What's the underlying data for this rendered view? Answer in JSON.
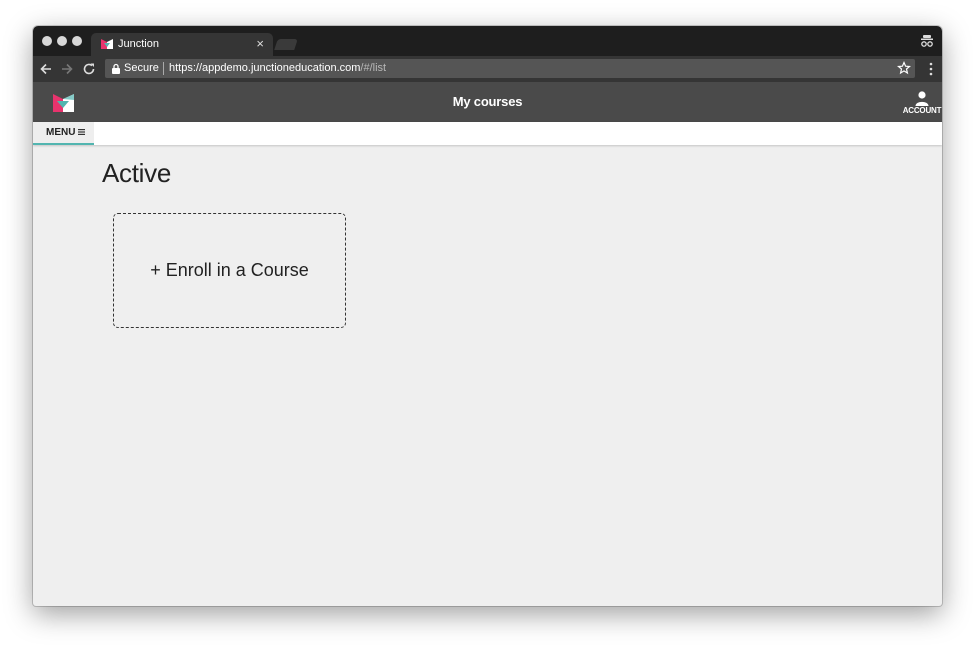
{
  "browser": {
    "tab": {
      "title": "Junction",
      "close_glyph": "×"
    },
    "omnibox": {
      "secure_label": "Secure",
      "url_scheme": "https://",
      "url_host": "appdemo.junctioneducation.com",
      "url_path": "/#/list"
    },
    "icons": [
      "back-arrow-icon",
      "forward-arrow-icon",
      "reload-icon",
      "lock-icon",
      "star-icon",
      "kebab-menu-icon",
      "incognito-icon"
    ]
  },
  "app": {
    "brand_colors": {
      "pink": "#e8336d",
      "teal": "#52b5b0",
      "white": "#ffffff"
    },
    "header": {
      "title": "My courses",
      "account_label": "ACCOUNT"
    },
    "menu": {
      "label": "MENU",
      "accent_color": "#52b5b0"
    },
    "main": {
      "section_title": "Active",
      "enroll_card_label": "+ Enroll in a Course"
    }
  }
}
